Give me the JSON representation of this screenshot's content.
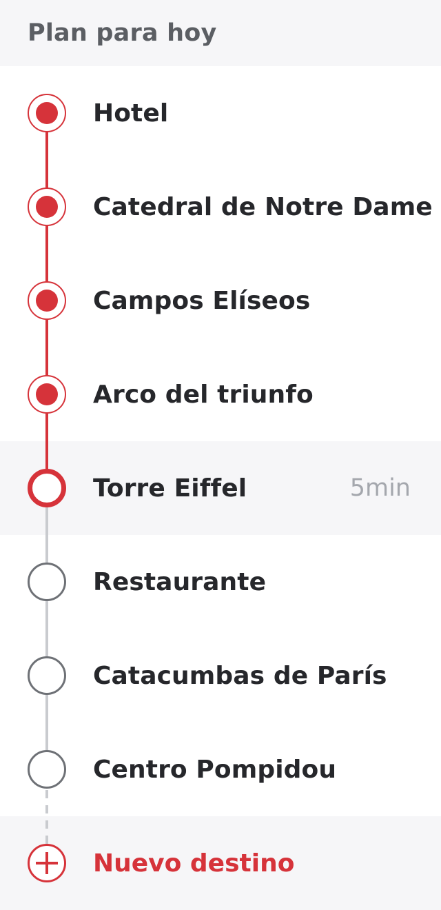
{
  "header": {
    "title": "Plan para hoy"
  },
  "stops": [
    {
      "label": "Hotel",
      "status": "done",
      "eta": ""
    },
    {
      "label": "Catedral de Notre Dame",
      "status": "done",
      "eta": ""
    },
    {
      "label": "Campos Elíseos",
      "status": "done",
      "eta": ""
    },
    {
      "label": "Arco del triunfo",
      "status": "done",
      "eta": ""
    },
    {
      "label": "Torre Eiffel",
      "status": "current",
      "eta": "5min"
    },
    {
      "label": "Restaurante",
      "status": "pending",
      "eta": ""
    },
    {
      "label": "Catacumbas de París",
      "status": "pending",
      "eta": ""
    },
    {
      "label": "Centro Pompidou",
      "status": "pending",
      "eta": ""
    }
  ],
  "add_destination": {
    "label": "Nuevo destino",
    "icon": "plus-circle-icon"
  },
  "colors": {
    "accent": "#d6333a",
    "pending": "#6e7176",
    "line_pending": "#c9cbcf",
    "text": "#26272b",
    "muted": "#a4a7ad",
    "header_bg": "#f6f6f8"
  }
}
